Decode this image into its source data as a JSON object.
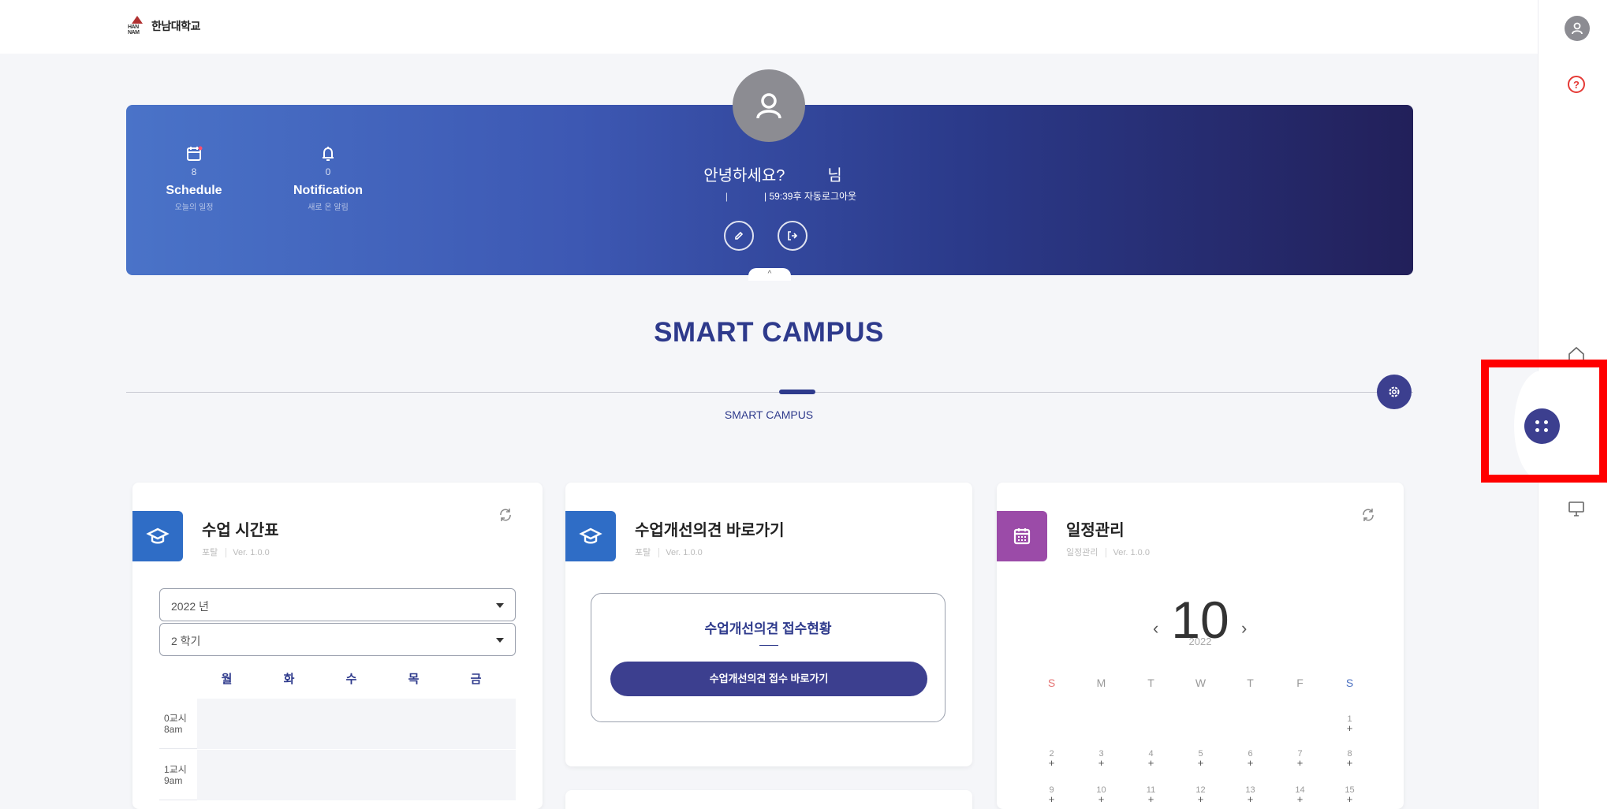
{
  "header": {
    "logo_mark_text": "HAN NAM",
    "logo_name": "한남대학교"
  },
  "rail": {
    "help_label": "?"
  },
  "banner": {
    "schedule": {
      "count": "8",
      "title": "Schedule",
      "subtitle": "오늘의 일정"
    },
    "notification": {
      "count": "0",
      "title": "Notification",
      "subtitle": "새로 온 알림"
    },
    "greeting": "안녕하세요?",
    "greeting_suffix": "님",
    "session_sep1": "|",
    "session_text": "| 59:39후 자동로그아웃",
    "collapse_label": "^"
  },
  "section": {
    "title": "SMART CAMPUS",
    "subtitle": "SMART CAMPUS"
  },
  "timetable": {
    "title": "수업 시간표",
    "category": "포탈",
    "version": "Ver. 1.0.0",
    "year_select": "2022 년",
    "term_select": "2 학기",
    "days": [
      "월",
      "화",
      "수",
      "목",
      "금"
    ],
    "rows": [
      {
        "period": "0교시",
        "time": "8am"
      },
      {
        "period": "1교시",
        "time": "9am"
      }
    ]
  },
  "feedback": {
    "title": "수업개선의견 바로가기",
    "category": "포탈",
    "version": "Ver. 1.0.0",
    "box_title": "수업개선의견 접수현황",
    "button_label": "수업개선의견 접수 바로가기"
  },
  "schedule_card": {
    "title": "일정관리",
    "category": "일정관리",
    "version": "Ver. 1.0.0",
    "month": "10",
    "year": "2022",
    "prev": "‹",
    "next": "›",
    "weekdays": [
      "S",
      "M",
      "T",
      "W",
      "T",
      "F",
      "S"
    ],
    "weeks": [
      [
        "",
        "",
        "",
        "",
        "",
        "",
        "1"
      ],
      [
        "2",
        "3",
        "4",
        "5",
        "6",
        "7",
        "8"
      ],
      [
        "9",
        "10",
        "11",
        "12",
        "13",
        "14",
        "15"
      ]
    ]
  },
  "colors": {
    "brand_navy": "#2e3a8c",
    "button_indigo": "#3c3f8f",
    "timetable_icon": "#2f6dc6",
    "schedule_icon": "#9b4ba8",
    "highlight": "#ff0000"
  }
}
